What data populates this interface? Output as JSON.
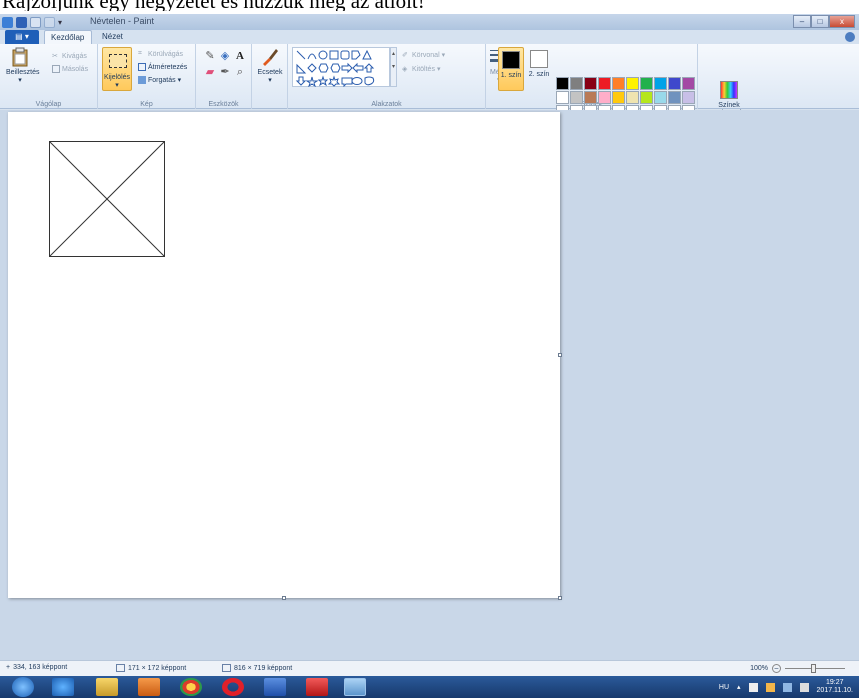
{
  "caption": "Rajzoljunk egy négyzetet és húzzuk meg az átlóit!",
  "window": {
    "title": "Névtelen - Paint",
    "controls": [
      "–",
      "□",
      "x"
    ]
  },
  "tabs": {
    "file": "▤ ▾",
    "home": "Kezdőlap",
    "view": "Nézet"
  },
  "ribbon": {
    "clipboard": {
      "group_label": "Vágólap",
      "paste": "Beillesztés",
      "cut": "Kivágás",
      "copy": "Másolás"
    },
    "image": {
      "group_label": "Kép",
      "select": "Kijelölés",
      "crop": "Körülvágás",
      "resize": "Átméretezés",
      "rotate": "Forgatás"
    },
    "tools": {
      "group_label": "Eszközök"
    },
    "brushes": {
      "label": "Ecsetek"
    },
    "shapes": {
      "group_label": "Alakzatok",
      "outline": "Körvonal",
      "fill": "Kitöltés"
    },
    "size": {
      "label": "Méret"
    },
    "colors": {
      "group_label": "Színek",
      "color1": "1. szín",
      "color2": "2. szín",
      "edit": "Színek szerkesztése",
      "color1_value": "#000000",
      "color2_value": "#ffffff",
      "palette": [
        "#000000",
        "#7f7f7f",
        "#880015",
        "#ed1c24",
        "#ff7f27",
        "#fff200",
        "#22b14c",
        "#00a2e8",
        "#3f48cc",
        "#a349a4",
        "#ffffff",
        "#c3c3c3",
        "#b97a57",
        "#ffaec9",
        "#ffc90e",
        "#efe4b0",
        "#b5e61d",
        "#99d9ea",
        "#7092be",
        "#c8bfe7",
        "#ffffff",
        "#ffffff",
        "#ffffff",
        "#ffffff",
        "#ffffff",
        "#ffffff",
        "#ffffff",
        "#ffffff",
        "#ffffff",
        "#ffffff"
      ]
    }
  },
  "statusbar": {
    "cursor_pos": "334, 163 képpont",
    "selection_size": "171 × 172 képpont",
    "canvas_size": "816 × 719 képpont",
    "zoom": "100%"
  },
  "taskbar": {
    "language": "HU",
    "time": "19:27",
    "date": "2017.11.10."
  }
}
